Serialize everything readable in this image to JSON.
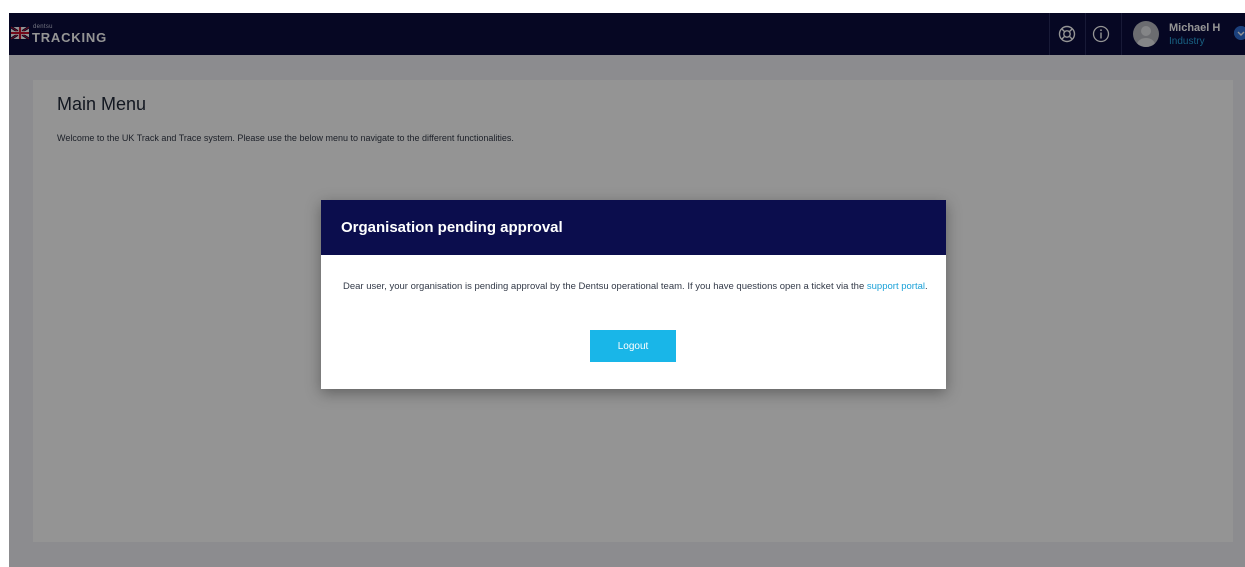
{
  "header": {
    "brand_small": "dentsu",
    "brand": "TRACKING",
    "user": {
      "name": "Michael H",
      "role": "Industry"
    }
  },
  "main": {
    "title": "Main Menu",
    "description": "Welcome to the UK Track and Trace system. Please use the below menu to navigate to the different functionalities."
  },
  "modal": {
    "title": "Organisation pending approval",
    "text_before": "Dear user, your organisation is pending approval by the Dentsu operational team. If you have questions open a ticket via the ",
    "link_text": "support portal",
    "text_after": ".",
    "button_label": "Logout"
  },
  "icons": [
    "uk-flag-icon",
    "help-lifebuoy-icon",
    "info-icon",
    "avatar",
    "chevron-down-icon"
  ],
  "colors": {
    "topbar": "#0b0d3d",
    "modal_header": "#0b0d4d",
    "accent": "#19b6e8",
    "link": "#1aa1d8"
  }
}
